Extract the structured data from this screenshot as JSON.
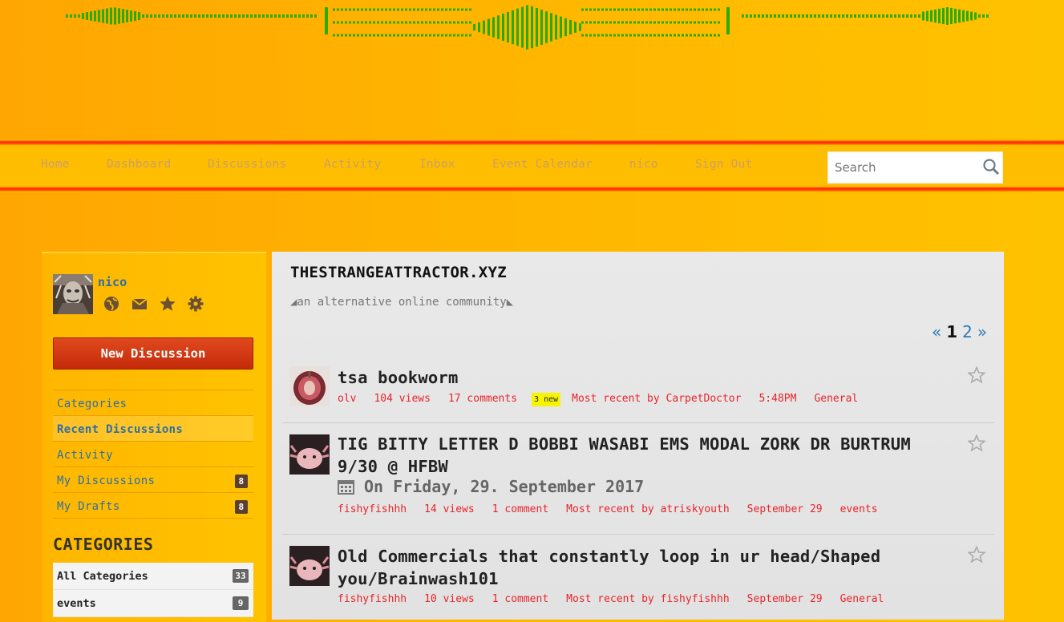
{
  "nav": {
    "items": [
      "Home",
      "Dashboard",
      "Discussions",
      "Activity",
      "Inbox",
      "Event Calendar",
      "nico",
      "Sign Out"
    ],
    "search_placeholder": "Search"
  },
  "me": {
    "username": "nico",
    "icons": [
      "globe-icon",
      "mail-icon",
      "star-icon",
      "gear-icon"
    ]
  },
  "sidebar": {
    "new_discussion": "New Discussion",
    "panel": [
      {
        "label": "Categories",
        "count": ""
      },
      {
        "label": "Recent Discussions",
        "count": ""
      },
      {
        "label": "Activity",
        "count": ""
      },
      {
        "label": "My Discussions",
        "count": "8"
      },
      {
        "label": "My Drafts",
        "count": "8"
      }
    ],
    "categories_heading": "CATEGORIES",
    "categories": [
      {
        "label": "All Categories",
        "count": "33"
      },
      {
        "label": "events",
        "count": "9"
      }
    ]
  },
  "site": {
    "title": "THESTRANGEATTRACTOR.XYZ",
    "subtitle": "◢an alternative online community◣"
  },
  "pager": {
    "prev": "«",
    "current": "1",
    "next_page": "2",
    "next": "»"
  },
  "discussions": [
    {
      "title": "tsa bookworm",
      "author": "olv",
      "views": "104 views",
      "comments": "17 comments",
      "new_badge": "3 new",
      "recent": "Most recent by CarpetDoctor",
      "time": "5:48PM",
      "category": "General"
    },
    {
      "title": "TIG BITTY LETTER D BOBBI WASABI EMS MODAL ZORK DR BURTRUM 9/30 @ HFBW",
      "event_date": "On Friday, 29. September 2017",
      "author": "fishyfishhh",
      "views": "14 views",
      "comments": "1 comment",
      "recent": "Most recent by atriskyouth",
      "time": "September 29",
      "category": "events"
    },
    {
      "title": "Old Commercials that constantly loop in ur head/Shaped you/Brainwash101",
      "author": "fishyfishhh",
      "views": "10 views",
      "comments": "1 comment",
      "recent": "Most recent by fishyfishhh",
      "time": "September 29",
      "category": "General"
    }
  ],
  "colors": {
    "accent_link": "#2d6fa7",
    "meta_red": "#e8242a",
    "banner_green": "#2aab00",
    "new_button": "#c42a0a"
  }
}
